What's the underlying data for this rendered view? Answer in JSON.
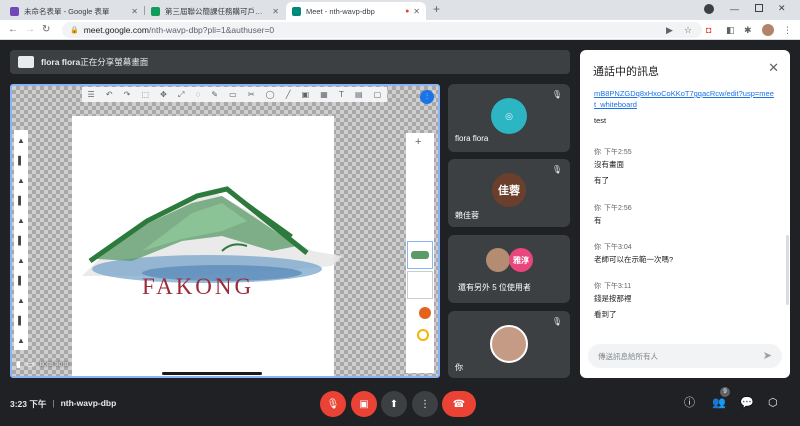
{
  "browser": {
    "tabs": [
      {
        "title": "未命名表單 - Google 表單",
        "favicon_color": "#7248b9",
        "active": false
      },
      {
        "title": "第三屆聯公簡課任務購可戶外動",
        "favicon_color": "#0f9d58",
        "active": false
      },
      {
        "title": "Meet - nth-wavp-dbp",
        "favicon_color": "#00897b",
        "active": true
      }
    ],
    "new_tab": "+",
    "url_host": "meet.google.com",
    "url_rest": "/nth-wavp-dbp?pli=1&authuser=0"
  },
  "presenter_banner": {
    "name": "flora flora",
    "suffix": "正在分享螢幕畫面"
  },
  "presentation": {
    "logo_text": "FAKONG",
    "presenter_label": "flora flora"
  },
  "participants": [
    {
      "name": "flora flora",
      "avatar_text": "",
      "avatar_color": "#2cb5c2"
    },
    {
      "name": "賴佳蓉",
      "avatar_text": "佳蓉",
      "avatar_color": "#6b3f2c"
    },
    {
      "name": "還有另外 5 位使用者",
      "avatar_text": "雅淳",
      "avatar_color": "#e8467c"
    },
    {
      "name": "你",
      "avatar_text": "",
      "avatar_color": "#c69b86"
    }
  ],
  "chat": {
    "title": "通話中的訊息",
    "link_text": "mB8PNZGDq8xHxoCoKKoT7gqacRcw/edit?usp=meet_whiteboard",
    "first_msg": "test",
    "groups": [
      {
        "sender": "你",
        "time": "下午2:55",
        "messages": [
          "沒有畫面",
          "有了"
        ]
      },
      {
        "sender": "你",
        "time": "下午2:56",
        "messages": [
          "有"
        ]
      },
      {
        "sender": "你",
        "time": "下午3:04",
        "messages": [
          "老師可以在示範一次嗎?"
        ]
      },
      {
        "sender": "你",
        "time": "下午3:11",
        "messages": [
          "錢是按那裡",
          "看到了"
        ]
      }
    ],
    "input_placeholder": "傳送訊息給所有人"
  },
  "bottom": {
    "time": "3:23 下午",
    "divider": "|",
    "meeting_code": "nth-wavp-dbp",
    "people_count": "9"
  },
  "colors": {
    "end_call": "#ea4335",
    "muted": "#ea4335",
    "accent": "#8ab4f8"
  }
}
